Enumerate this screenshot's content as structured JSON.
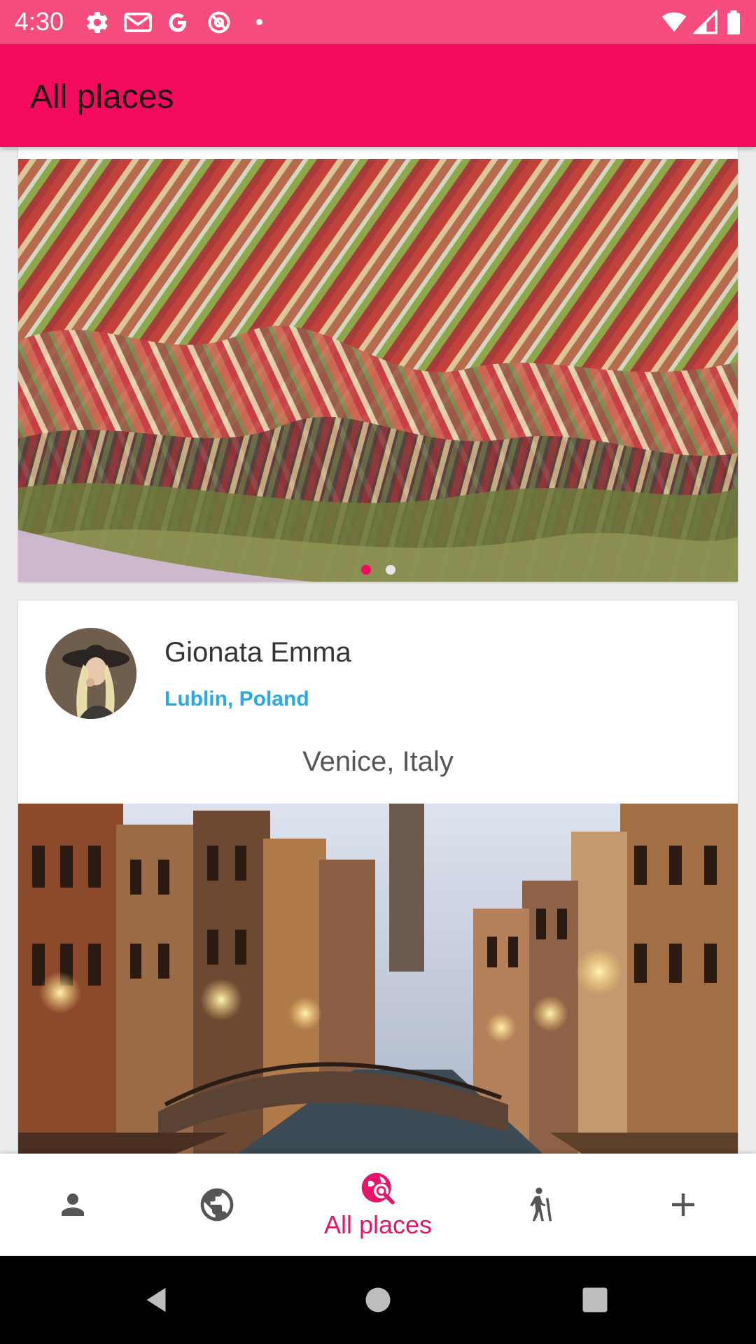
{
  "status_bar": {
    "time": "4:30",
    "left_icons": [
      "gear-icon",
      "gmail-icon",
      "google-icon",
      "at-sign-icon",
      "dot-icon"
    ],
    "right_icons": [
      "wifi-icon",
      "signal-icon",
      "battery-icon"
    ],
    "background": "#f64d7c"
  },
  "app_bar": {
    "title": "All places",
    "background": "#f50a5f"
  },
  "feed": {
    "carousel": {
      "image": "colorful-striped-mountains-photo",
      "page_count": 2,
      "active_page": 1
    },
    "post": {
      "user_name": "Gionata Emma",
      "user_location": "Lublin, Poland",
      "place_title": "Venice, Italy",
      "avatar": "woman-in-hat-avatar",
      "image": "venice-canal-night-photo"
    }
  },
  "bottom_nav": {
    "items": [
      {
        "icon": "person-icon",
        "label": "",
        "active": false
      },
      {
        "icon": "globe-icon",
        "label": "",
        "active": false
      },
      {
        "icon": "search-globe-icon",
        "label": "All places",
        "active": true
      },
      {
        "icon": "hiker-icon",
        "label": "",
        "active": false
      },
      {
        "icon": "plus-icon",
        "label": "",
        "active": false
      }
    ],
    "active_color": "#e4156a",
    "inactive_color": "#555555"
  },
  "system_nav": {
    "buttons": [
      "back-icon",
      "home-icon",
      "recents-icon"
    ]
  },
  "colors": {
    "accent": "#f50a5f",
    "link_blue": "#29aae1"
  }
}
